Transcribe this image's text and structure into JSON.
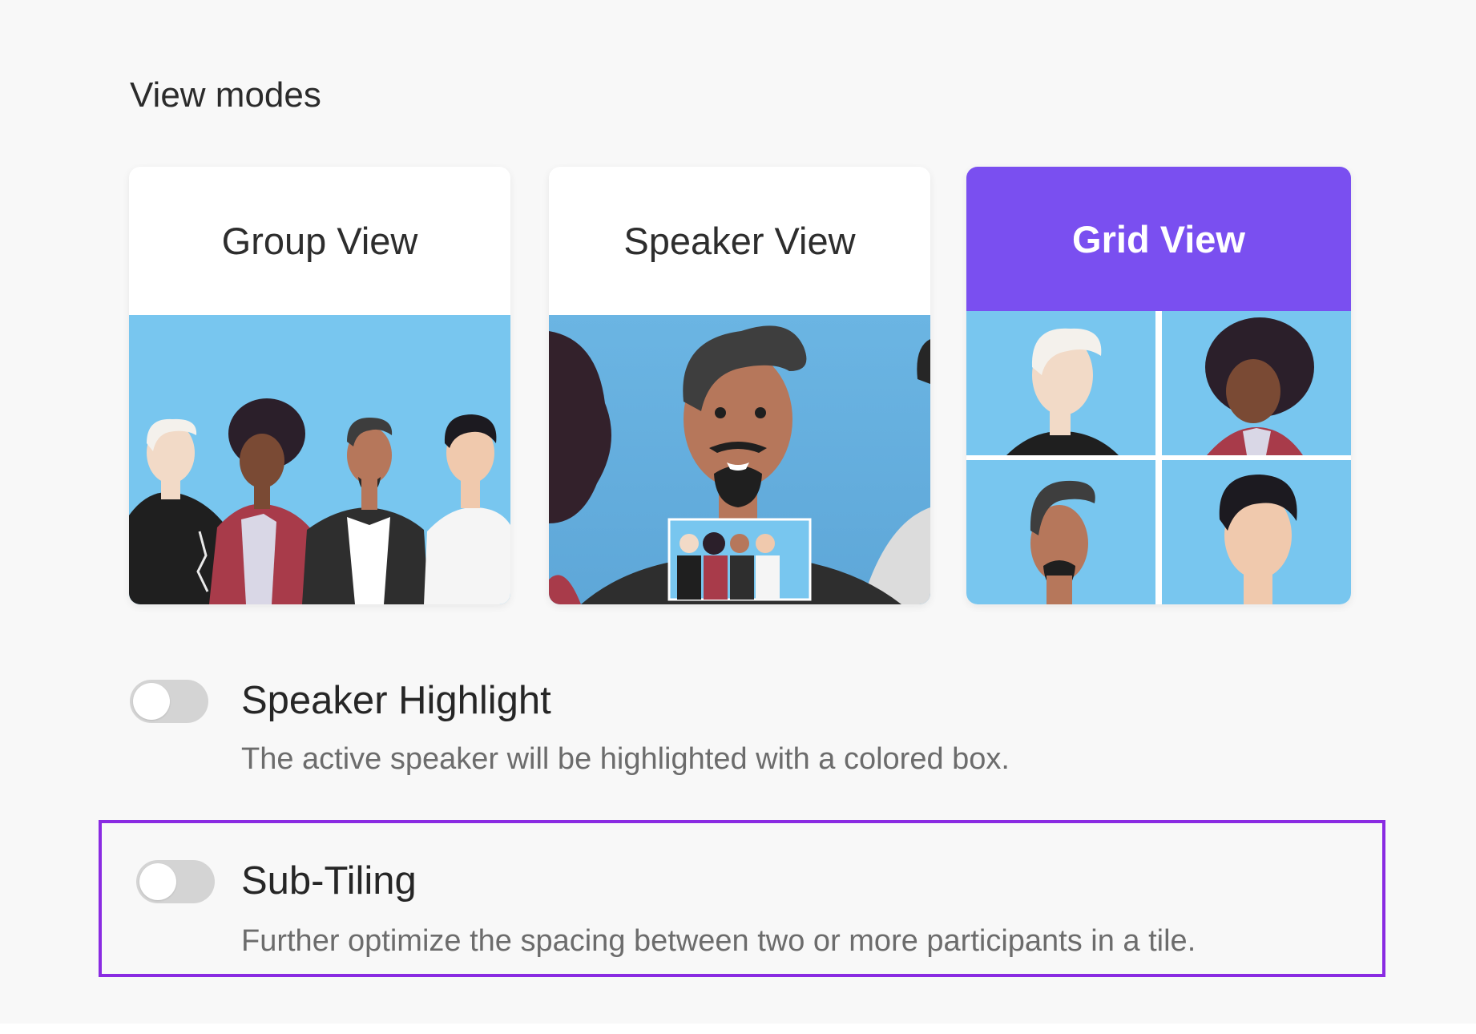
{
  "section": {
    "title": "View modes"
  },
  "view_modes": [
    {
      "label": "Group View",
      "selected": false
    },
    {
      "label": "Speaker View",
      "selected": false
    },
    {
      "label": "Grid View",
      "selected": true
    }
  ],
  "options": [
    {
      "title": "Speaker Highlight",
      "description": "The active speaker will be highlighted with a colored box.",
      "enabled": false
    },
    {
      "title": "Sub-Tiling",
      "description": "Further optimize the spacing between two or more participants in a tile.",
      "enabled": false
    }
  ],
  "colors": {
    "accent": "#7a4ff0",
    "illustration_sky": "#78c6ef",
    "highlight_border": "#8a2be2",
    "toggle_off": "#d4d4d4"
  }
}
